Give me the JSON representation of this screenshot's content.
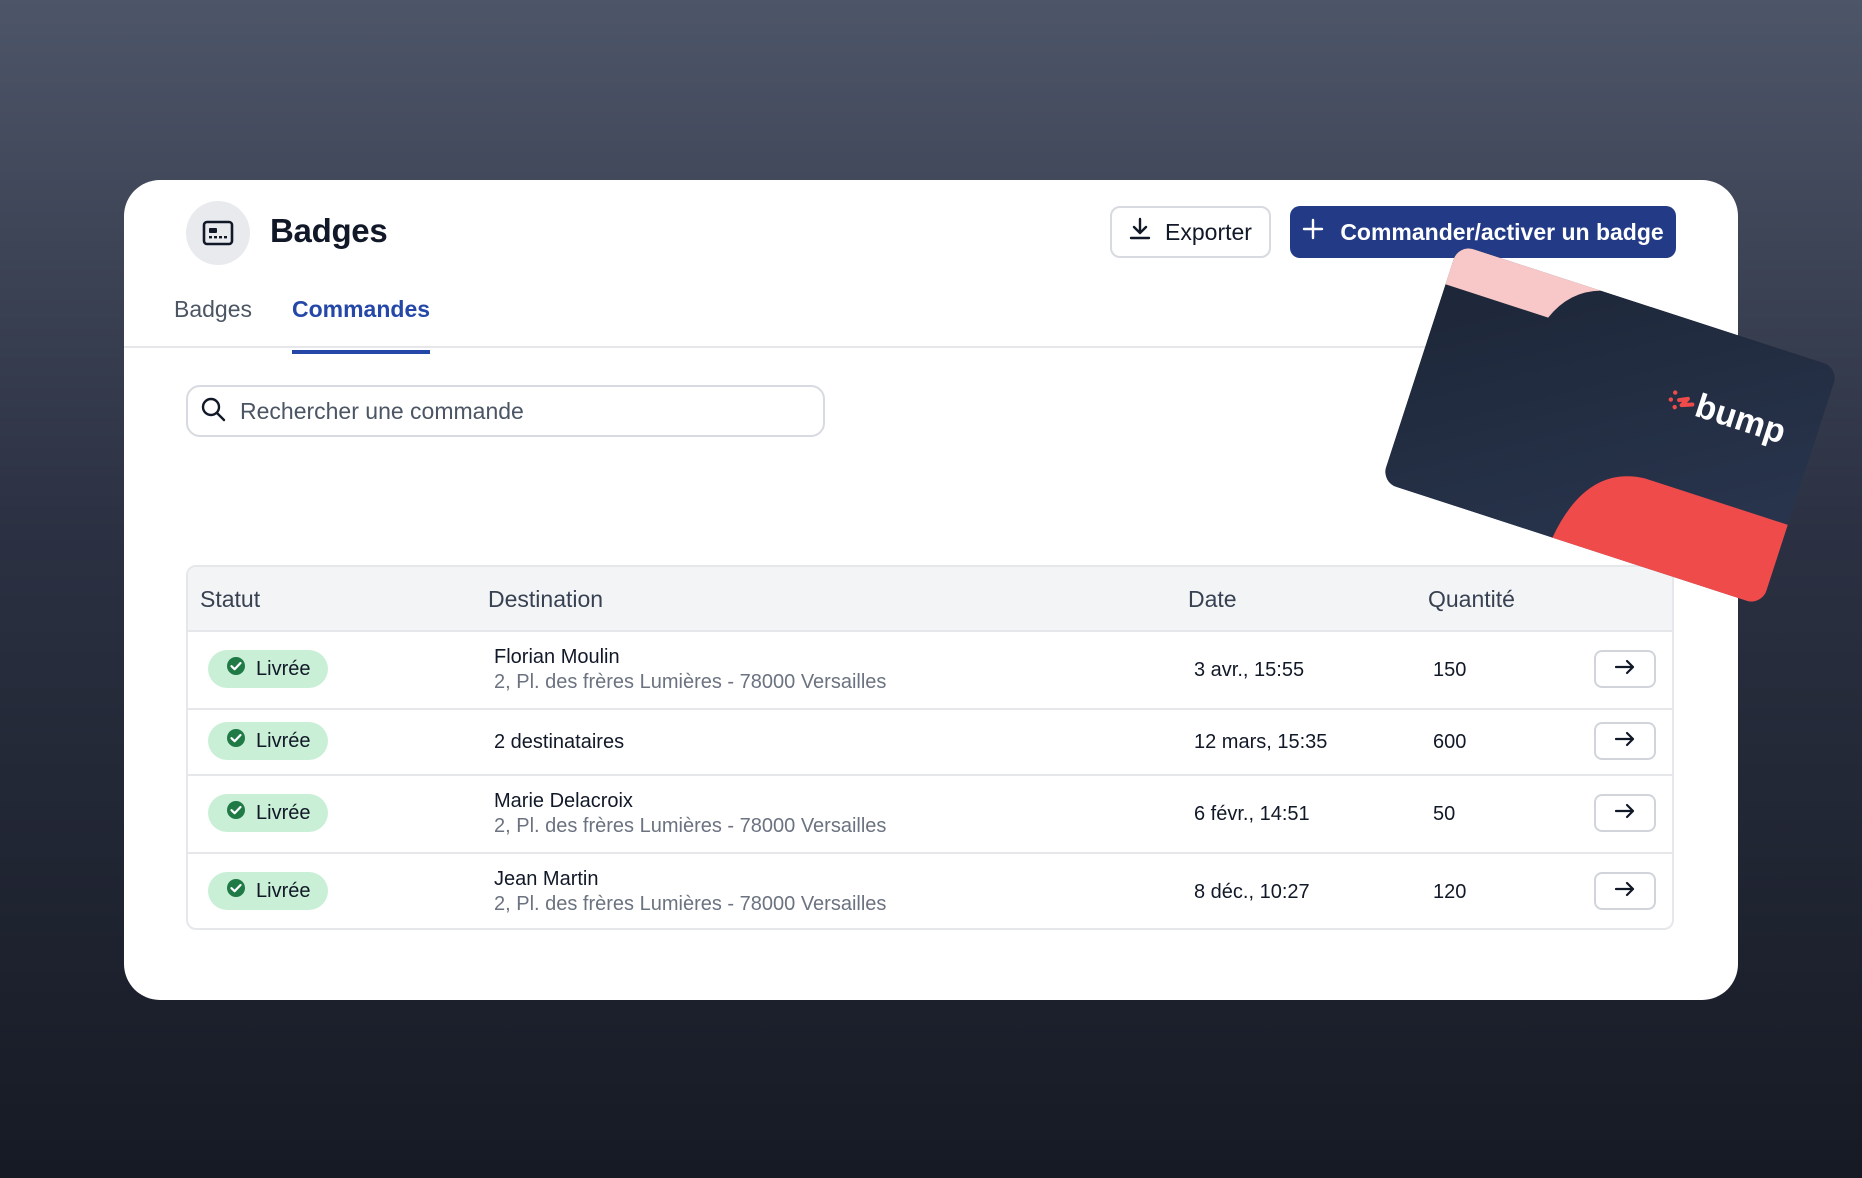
{
  "header": {
    "title": "Badges",
    "export_label": "Exporter",
    "order_label": "Commander/activer un badge"
  },
  "tabs": [
    {
      "label": "Badges",
      "active": false
    },
    {
      "label": "Commandes",
      "active": true
    }
  ],
  "search": {
    "placeholder": "Rechercher une commande",
    "value": ""
  },
  "table": {
    "columns": [
      "Statut",
      "Destination",
      "Date",
      "Quantité"
    ],
    "rows": [
      {
        "status": "Livrée",
        "name": "Florian Moulin",
        "address": "2, Pl. des frères Lumières - 78000 Versailles",
        "date": "3 avr., 15:55",
        "quantity": "150"
      },
      {
        "status": "Livrée",
        "name": "2 destinataires",
        "address": "",
        "date": "12 mars, 15:35",
        "quantity": "600"
      },
      {
        "status": "Livrée",
        "name": "Marie Delacroix",
        "address": "2, Pl. des frères Lumières - 78000 Versailles",
        "date": "6 févr., 14:51",
        "quantity": "50"
      },
      {
        "status": "Livrée",
        "name": "Jean Martin",
        "address": "2, Pl. des frères Lumières - 78000 Versailles",
        "date": "8 déc., 10:27",
        "quantity": "120"
      }
    ]
  },
  "card": {
    "brand": "bump"
  },
  "colors": {
    "primary": "#233b86",
    "tab_active": "#2447a8",
    "status_bg": "#c9f0d6",
    "status_icon": "#1f7a45",
    "card_dark": "#1f2a3d",
    "card_red": "#f04b4b",
    "card_pink": "#f8c7c7"
  }
}
